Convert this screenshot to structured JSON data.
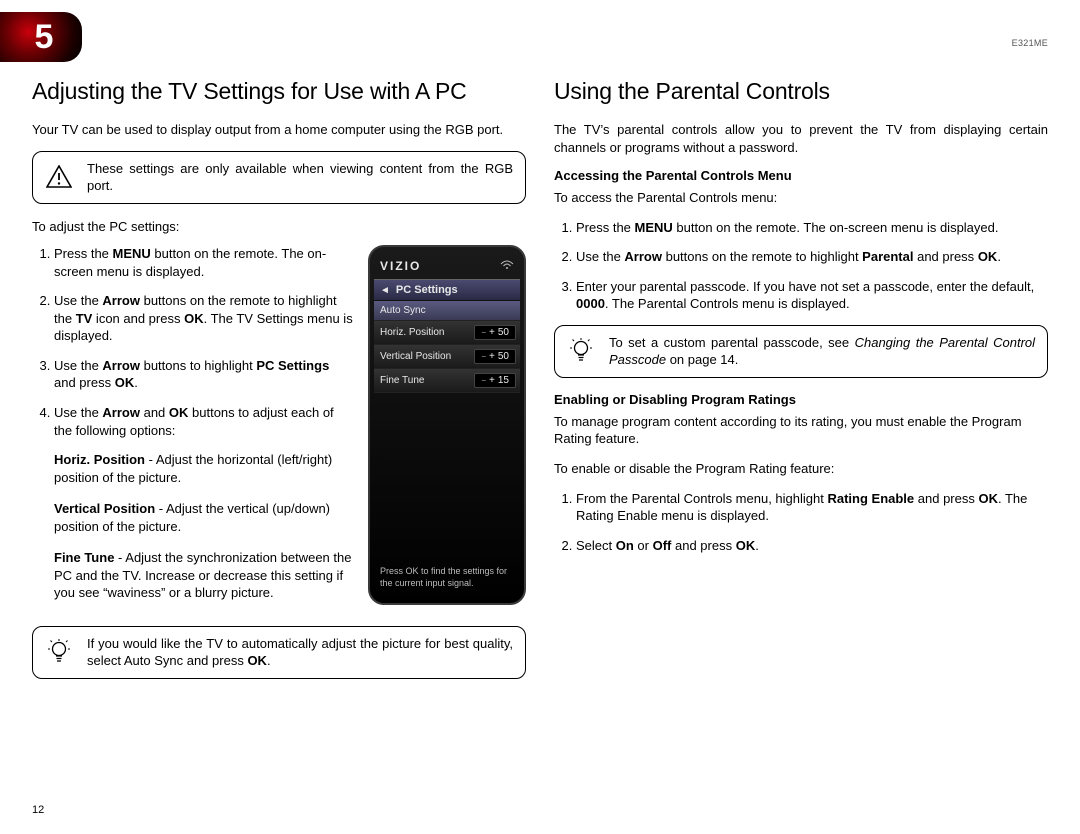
{
  "model": "E321ME",
  "chapter_number": "5",
  "page_number": "12",
  "left": {
    "heading": "Adjusting the TV Settings for Use with A PC",
    "intro": "Your TV can be used to display output from a home computer using the RGB port.",
    "warning": "These settings are only available when viewing content from the RGB port.",
    "adjust_intro": "To adjust the PC settings:",
    "step1a": "Press the ",
    "step1_menu": "MENU",
    "step1b": " button on the remote. The on-screen menu is displayed.",
    "step2a": "Use the ",
    "step2_arrow": "Arrow",
    "step2b": " buttons on the remote to highlight the ",
    "step2_tv": "TV",
    "step2c": " icon and press ",
    "step2_ok": "OK",
    "step2d": ". The TV Settings menu is displayed.",
    "step3a": "Use the ",
    "step3_arrow": "Arrow",
    "step3b": " buttons to highlight ",
    "step3_pcs": "PC Settings",
    "step3c": " and press ",
    "step3_ok": "OK",
    "step3d": ".",
    "step4a": "Use the ",
    "step4_arrow": "Arrow",
    "step4b": " and ",
    "step4_ok": "OK",
    "step4c": " buttons to adjust each of the following options:",
    "opt1_label": "Horiz. Position",
    "opt1_text": " - Adjust the horizontal (left/right) position of the picture.",
    "opt2_label": "Vertical Position",
    "opt2_text": " - Adjust the vertical (up/down) position of the picture.",
    "opt3_label": "Fine Tune",
    "opt3_text": " - Adjust the synchronization between the PC and the TV. Increase or decrease this setting if you see “waviness” or a blurry picture.",
    "tip_a": "If you would like the TV to automatically adjust the picture for best quality, select Auto Sync and press ",
    "tip_ok": "OK",
    "tip_b": "."
  },
  "tv_menu": {
    "brand": "VIZIO",
    "title": "PC Settings",
    "rows": {
      "auto_sync": "Auto Sync",
      "horiz_label": "Horiz. Position",
      "horiz_val": "50",
      "vert_label": "Vertical Position",
      "vert_val": "50",
      "fine_label": "Fine Tune",
      "fine_val": "15"
    },
    "hint": "Press OK to find the settings for the current input signal."
  },
  "right": {
    "heading": "Using the Parental Controls",
    "intro": "The TV’s parental controls allow you to prevent the TV from displaying certain channels or programs without a password.",
    "sub1": "Accessing the Parental Controls Menu",
    "sub1_intro": "To access the Parental Controls menu:",
    "s1a": "Press the ",
    "s1_menu": "MENU",
    "s1b": " button on the remote. The on-screen menu is displayed.",
    "s2a": "Use the ",
    "s2_arrow": "Arrow",
    "s2b": " buttons on the remote to highlight ",
    "s2_parental": "Parental",
    "s2c": " and press ",
    "s2_ok": "OK",
    "s2d": ".",
    "s3a": "Enter your parental passcode. If you have not set a passcode, enter the default, ",
    "s3_code": "0000",
    "s3b": ". The Parental Controls menu is displayed.",
    "tip_a": "To set a custom parental passcode, see ",
    "tip_i": "Changing the Parental Control Passcode",
    "tip_b": " on page 14.",
    "sub2": "Enabling or Disabling Program Ratings",
    "sub2_p1": "To manage program content according to its rating, you must enable the Program Rating feature.",
    "sub2_p2": "To enable or disable the Program Rating feature:",
    "r1a": "From the Parental Controls menu, highlight ",
    "r1_re": "Rating Enable",
    "r1b": " and press ",
    "r1_ok": "OK",
    "r1c": ". The Rating Enable menu is displayed.",
    "r2a": "Select ",
    "r2_on": "On",
    "r2b": " or ",
    "r2_off": "Off",
    "r2c": " and press ",
    "r2_ok": "OK",
    "r2d": "."
  }
}
